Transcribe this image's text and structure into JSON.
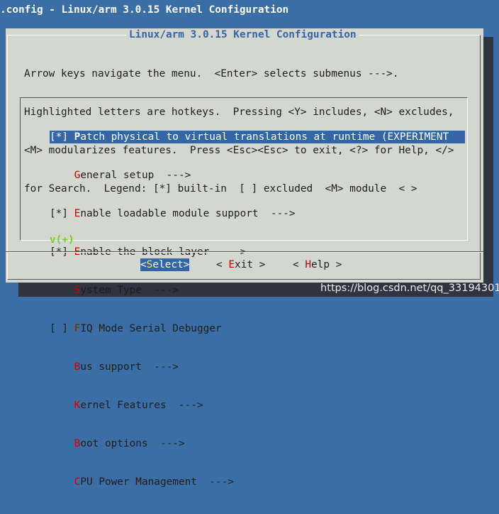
{
  "window": {
    "title": ".config - Linux/arm 3.0.15 Kernel Configuration"
  },
  "dialog": {
    "title": "Linux/arm 3.0.15 Kernel Configuration",
    "help_lines": [
      "Arrow keys navigate the menu.  <Enter> selects submenus --->.",
      "Highlighted letters are hotkeys.  Pressing <Y> includes, <N> excludes,",
      "<M> modularizes features.  Press <Esc><Esc> to exit, <?> for Help, </>",
      "for Search.  Legend: [*] built-in  [ ] excluded  <M> module  < >"
    ]
  },
  "menu": {
    "items": [
      {
        "prefix": "[*] ",
        "hotkey": "P",
        "rest": "atch physical to virtual translations at runtime (EXPERIMENT",
        "selected": true
      },
      {
        "prefix": "    ",
        "hotkey": "G",
        "rest": "eneral setup  --->",
        "selected": false
      },
      {
        "prefix": "[*] ",
        "hotkey": "E",
        "rest": "nable loadable module support  --->",
        "selected": false
      },
      {
        "prefix": "[*] ",
        "hotkey": "E",
        "rest": "nable the block layer  --->",
        "selected": false
      },
      {
        "prefix": "    ",
        "hotkey": "S",
        "rest": "ystem Type  --->",
        "selected": false
      },
      {
        "prefix": "[ ] ",
        "hotkey": "F",
        "rest": "IQ Mode Serial Debugger",
        "selected": false
      },
      {
        "prefix": "    ",
        "hotkey": "B",
        "rest": "us support  --->",
        "selected": false
      },
      {
        "prefix": "    ",
        "hotkey": "K",
        "rest": "ernel Features  --->",
        "selected": false
      },
      {
        "prefix": "    ",
        "hotkey": "B",
        "rest": "oot options  --->",
        "selected": false
      },
      {
        "prefix": "    ",
        "hotkey": "C",
        "rest": "PU Power Management  --->",
        "selected": false
      }
    ],
    "more_indicator": "v(+)"
  },
  "buttons": {
    "select": {
      "left": "<",
      "hotkey": "S",
      "rest": "elect",
      "right": ">"
    },
    "exit": {
      "left": "< ",
      "hotkey": "E",
      "rest": "xit",
      "right": " >"
    },
    "help": {
      "left": "< ",
      "hotkey": "H",
      "rest": "elp",
      "right": " >"
    }
  },
  "watermark": "https://blog.csdn.net/qq_33194301",
  "colors": {
    "desktop": "#3a6ea5",
    "dialog": "#d3d7cf",
    "highlight": "#3465a4",
    "hotkey": "#cc0000",
    "indicator": "#73d216"
  }
}
